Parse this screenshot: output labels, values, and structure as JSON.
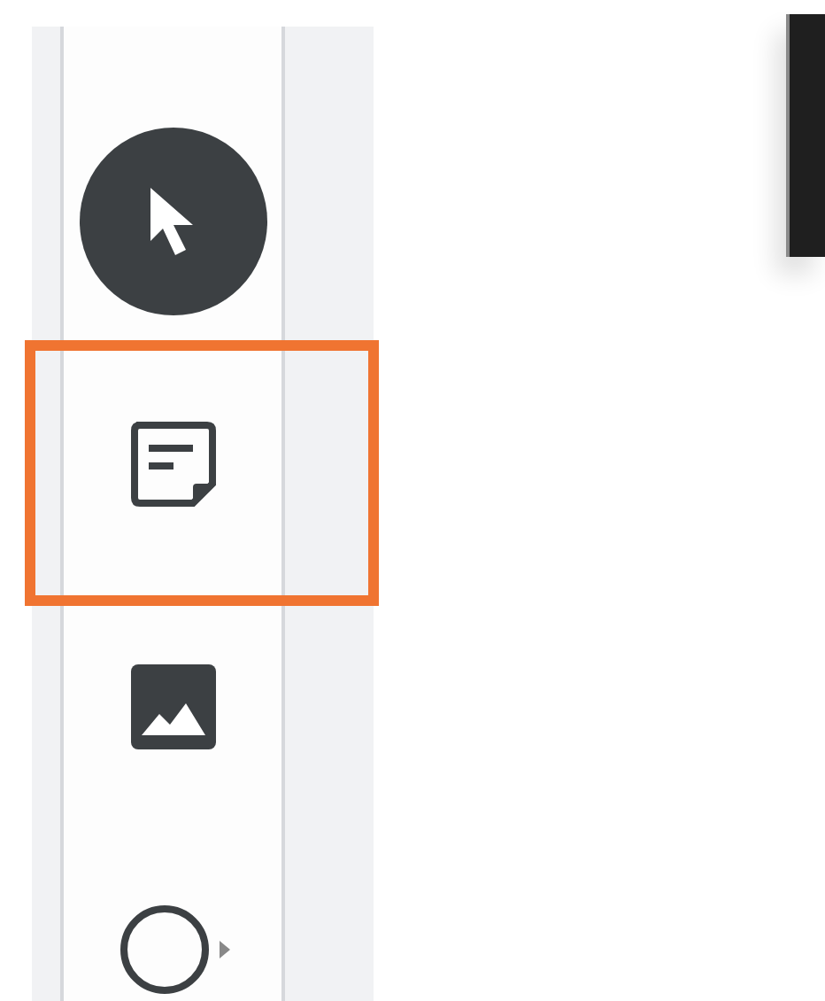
{
  "toolbar": {
    "tools": [
      {
        "kind": "pointer",
        "selected": true,
        "highlighted": false
      },
      {
        "kind": "note",
        "selected": false,
        "highlighted": true
      },
      {
        "kind": "image",
        "selected": false,
        "highlighted": false
      },
      {
        "kind": "shape",
        "selected": false,
        "highlighted": false
      }
    ]
  }
}
